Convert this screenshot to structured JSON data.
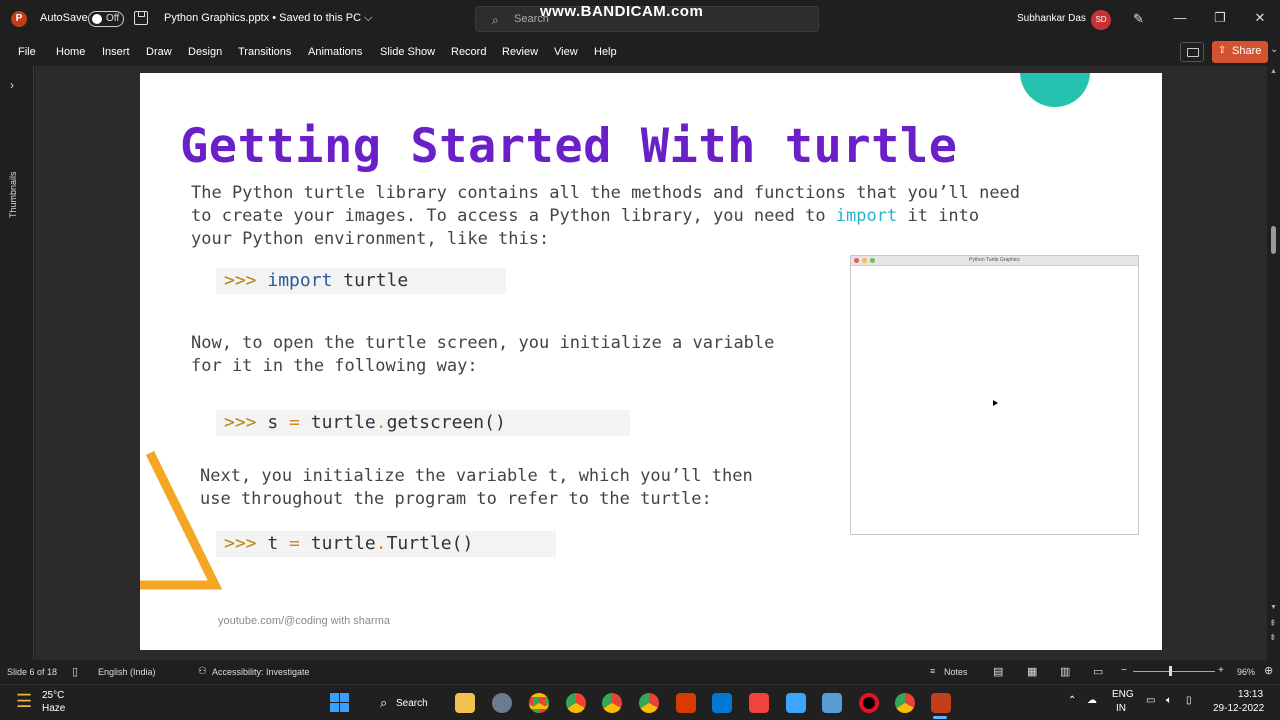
{
  "titlebar": {
    "app_logo": "P",
    "autosave_label": "AutoSave",
    "autosave_state": "Off",
    "filename": "Python Graphics.pptx • Saved to this PC ⌵",
    "search_placeholder": "Search",
    "watermark": "www.BANDICAM.com",
    "user_name": "Subhankar Das",
    "user_initials": "SD",
    "window_controls": {
      "minimize": "—",
      "restore": "❐",
      "close": "✕"
    }
  },
  "ribbon": {
    "tabs": [
      "File",
      "Home",
      "Insert",
      "Draw",
      "Design",
      "Transitions",
      "Animations",
      "Slide Show",
      "Record",
      "Review",
      "View",
      "Help"
    ],
    "share_label": "Share",
    "share_icon": "share-icon"
  },
  "thumbnails": {
    "label": "Thumbnails",
    "expand": "›"
  },
  "slide": {
    "title": "Getting Started With turtle",
    "para1_line1": "The Python turtle library contains all the methods and functions that you’ll need",
    "para1_line2_a": "to create your images. To access a Python library, you need to ",
    "para1_line2_kw": "import",
    "para1_line2_b": " it into",
    "para1_line3": "your Python environment, like this:",
    "code1": {
      "prompt": ">>> ",
      "kw": "import",
      "rest": " turtle"
    },
    "para2_line1": "Now, to open the turtle screen, you initialize a variable",
    "para2_line2": "for it in the following way:",
    "code2": {
      "prompt": ">>> ",
      "a": "s ",
      "op": "=",
      "b": " turtle",
      "dot": ".",
      "c": "getscreen()"
    },
    "para3_line1": "Next, you initialize the variable t, which you’ll then",
    "para3_line2": "use throughout the program to refer to the turtle:",
    "code3": {
      "prompt": ">>> ",
      "a": "t ",
      "op": "=",
      "b": " turtle",
      "dot": ".",
      "c": "Turtle()"
    },
    "footer": "youtube.com/@coding with sharma",
    "turtle_window_title": "Python Turtle Graphics",
    "colors": {
      "title": "#6a1fc8",
      "keyword": "#26b4c9",
      "accent_orange": "#f5a623",
      "teal": "#26c2b0"
    }
  },
  "statusbar": {
    "slide_info": "Slide 6 of 18",
    "language": "English (India)",
    "accessibility": "Accessibility: Investigate",
    "notes": "Notes",
    "zoom": "96%"
  },
  "taskbar": {
    "temperature": "25°C",
    "condition": "Haze",
    "search_label": "Search",
    "apps": [
      "file-explorer",
      "settings",
      "chrome",
      "chrome-alt",
      "chrome-2",
      "chrome-3",
      "office",
      "vscode",
      "anydesk",
      "notepad",
      "photos",
      "record",
      "chrome-4",
      "powerpoint"
    ],
    "lang_line1": "ENG",
    "lang_line2": "IN",
    "time": "13:13",
    "date": "29-12-2022"
  }
}
